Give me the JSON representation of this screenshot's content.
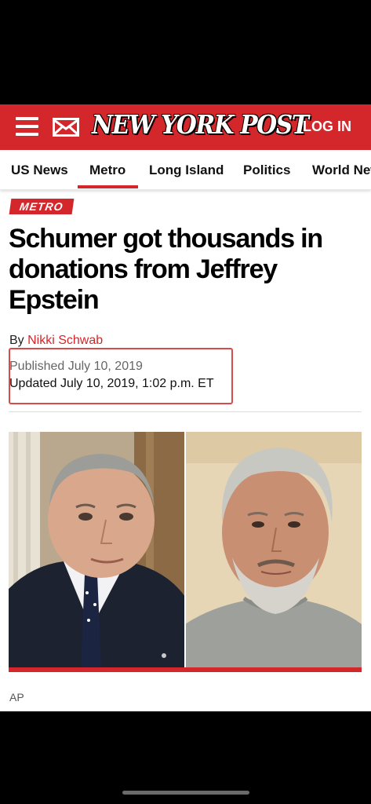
{
  "header": {
    "logo_text": "NEW YORK POST",
    "login_label": "LOG IN",
    "brand_color": "#d3272b"
  },
  "nav": {
    "items": [
      {
        "label": "US News"
      },
      {
        "label": "Metro"
      },
      {
        "label": "Long Island"
      },
      {
        "label": "Politics"
      },
      {
        "label": "World New"
      }
    ],
    "active": "Metro"
  },
  "article": {
    "section": "METRO",
    "headline": "Schumer got thousands in donations from Jeffrey Epstein",
    "byline_prefix": "By",
    "author": "Nikki Schwab",
    "published": "Published July 10, 2019",
    "updated": "Updated July 10, 2019, 1:02 p.m. ET",
    "photo_credit": "AP"
  },
  "icons": {
    "menu": "hamburger-menu-icon",
    "mail": "mail-envelope-icon"
  }
}
